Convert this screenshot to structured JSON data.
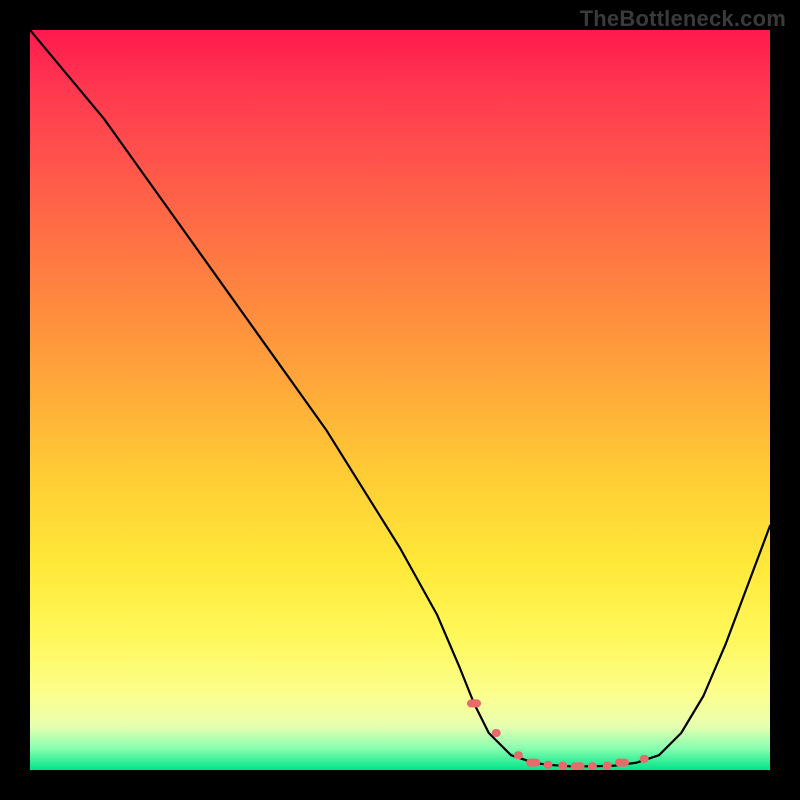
{
  "watermark": "TheBottleneck.com",
  "colors": {
    "curve": "#000000",
    "dots": "#e86a6a"
  },
  "chart_data": {
    "type": "line",
    "title": "",
    "xlabel": "",
    "ylabel": "",
    "xlim": [
      0,
      100
    ],
    "ylim": [
      0,
      100
    ],
    "grid": false,
    "legend": false,
    "series": [
      {
        "name": "bottleneck-curve",
        "x": [
          0,
          5,
          10,
          15,
          20,
          25,
          30,
          35,
          40,
          45,
          50,
          55,
          58,
          60,
          62,
          65,
          68,
          70,
          73,
          76,
          79,
          82,
          85,
          88,
          91,
          94,
          97,
          100
        ],
        "y": [
          100,
          94,
          88,
          81,
          74,
          67,
          60,
          53,
          46,
          38,
          30,
          21,
          14,
          9,
          5,
          2,
          1,
          0.7,
          0.5,
          0.5,
          0.6,
          1.0,
          2,
          5,
          10,
          17,
          25,
          33
        ]
      }
    ],
    "highlight_dots": {
      "name": "optimal-zone-dots",
      "x": [
        60,
        63,
        66,
        68,
        70,
        72,
        74,
        76,
        78,
        80,
        83
      ],
      "y": [
        9,
        5,
        2,
        1,
        0.7,
        0.6,
        0.5,
        0.5,
        0.6,
        1.0,
        1.5
      ]
    }
  }
}
